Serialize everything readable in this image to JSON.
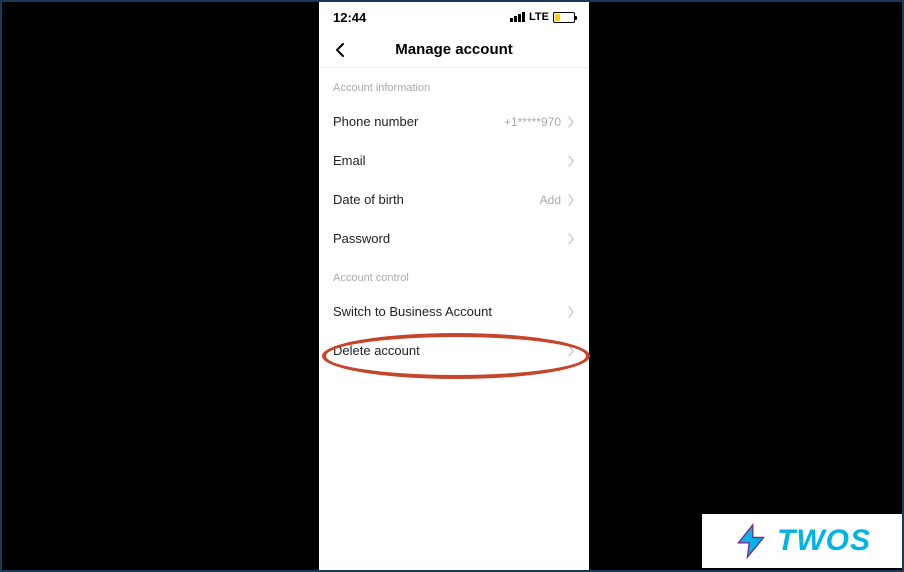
{
  "status": {
    "time": "12:44",
    "network": "LTE"
  },
  "header": {
    "title": "Manage account"
  },
  "sections": {
    "account_info": {
      "header": "Account information",
      "phone_label": "Phone number",
      "phone_value": "+1*****970",
      "email_label": "Email",
      "dob_label": "Date of birth",
      "dob_value": "Add",
      "password_label": "Password"
    },
    "account_control": {
      "header": "Account control",
      "switch_label": "Switch to Business Account",
      "delete_label": "Delete account"
    }
  },
  "badge": {
    "text": "TWOS"
  }
}
